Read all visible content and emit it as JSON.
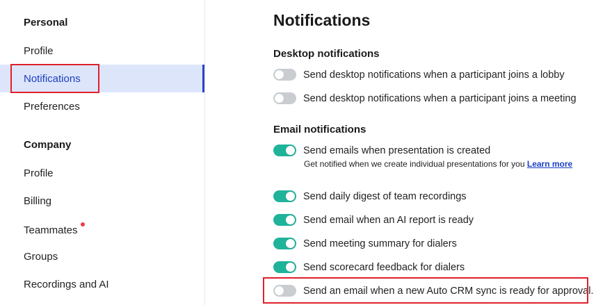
{
  "sidebar": {
    "personal_title": "Personal",
    "personal_items": [
      {
        "label": "Profile"
      },
      {
        "label": "Notifications",
        "active": true
      },
      {
        "label": "Preferences"
      }
    ],
    "company_title": "Company",
    "company_items": [
      {
        "label": "Profile"
      },
      {
        "label": "Billing"
      },
      {
        "label": "Teammates",
        "badge_dot": true
      },
      {
        "label": "Groups"
      },
      {
        "label": "Recordings and AI"
      }
    ]
  },
  "main": {
    "title": "Notifications",
    "desktop_title": "Desktop notifications",
    "desktop_settings": [
      {
        "label": "Send desktop notifications when a participant joins a lobby",
        "enabled": false
      },
      {
        "label": "Send desktop notifications when a participant joins a meeting",
        "enabled": false
      }
    ],
    "email_title": "Email notifications",
    "email_settings": [
      {
        "label": "Send emails when presentation is created",
        "enabled": true,
        "description": "Get notified when we create individual presentations for you",
        "link": "Learn more"
      },
      {
        "label": "Send daily digest of team recordings",
        "enabled": true
      },
      {
        "label": "Send email when an AI report is ready",
        "enabled": true
      },
      {
        "label": "Send meeting summary for dialers",
        "enabled": true
      },
      {
        "label": "Send scorecard feedback for dialers",
        "enabled": true
      },
      {
        "label": "Send an email when a new Auto CRM sync is ready for approval.",
        "enabled": false
      }
    ]
  },
  "colors": {
    "toggle_on": "#1fb39a",
    "toggle_off": "#c9cdd2",
    "active_nav_bg": "#dde5fb",
    "highlight_outline": "#e0202a",
    "link": "#1a3fc7"
  }
}
